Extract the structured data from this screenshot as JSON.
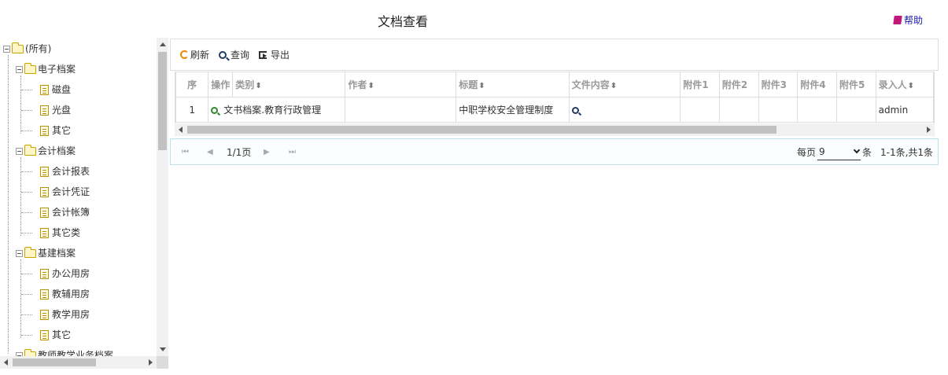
{
  "page_title": "文档查看",
  "help_label": "帮助",
  "tree": {
    "root": "(所有)",
    "groups": [
      {
        "label": "电子档案",
        "items": [
          "磁盘",
          "光盘",
          "其它"
        ]
      },
      {
        "label": "会计档案",
        "items": [
          "会计报表",
          "会计凭证",
          "会计帐簿",
          "其它类"
        ]
      },
      {
        "label": "基建档案",
        "items": [
          "办公用房",
          "教辅用房",
          "教学用房",
          "其它"
        ]
      },
      {
        "label": "教师教学业务档案",
        "items": []
      }
    ]
  },
  "toolbar": {
    "refresh_label": "刷新",
    "query_label": "查询",
    "export_label": "导出"
  },
  "grid": {
    "columns": [
      "序",
      "操作",
      "类别",
      "作者",
      "标题",
      "文件内容",
      "附件1",
      "附件2",
      "附件3",
      "附件4",
      "附件5",
      "录入人"
    ],
    "rows": [
      {
        "seq": "1",
        "category": "文书档案.教育行政管理",
        "author": "",
        "title": "中职学校安全管理制度",
        "att1": "",
        "att2": "",
        "att3": "",
        "att4": "",
        "att5": "",
        "recorder": "admin"
      }
    ]
  },
  "pager": {
    "page_info": "1/1页",
    "per_page_label": "每页",
    "per_page_value": "9",
    "unit_label": "条",
    "total": "1-1条,共1条"
  },
  "colors": {
    "accent_orange": "#f08a00",
    "view_green": "#2c8a2c",
    "help_blue": "#1a1aa6"
  }
}
